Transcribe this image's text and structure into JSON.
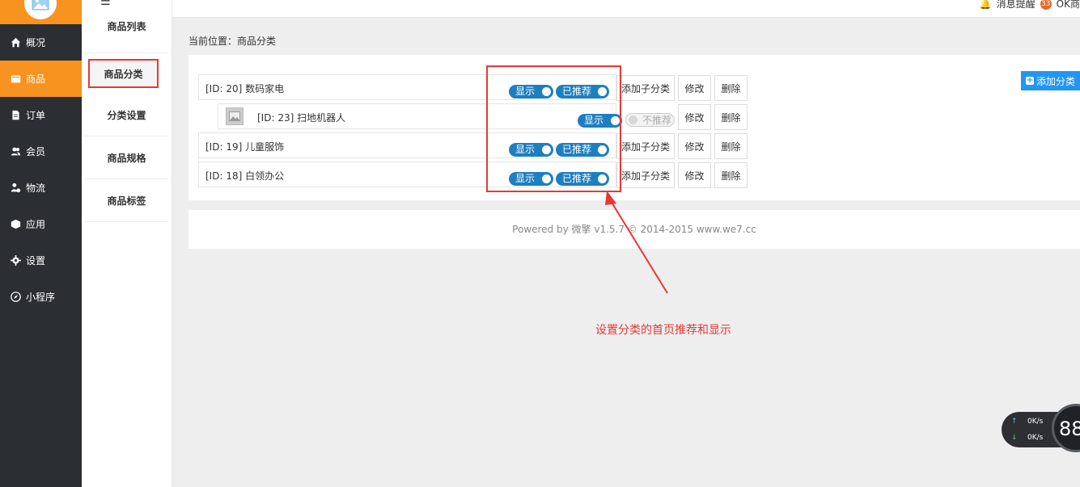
{
  "sidebar": {
    "items": [
      {
        "label": "概况",
        "icon": "home-icon"
      },
      {
        "label": "商品",
        "icon": "box-icon"
      },
      {
        "label": "订单",
        "icon": "document-icon"
      },
      {
        "label": "会员",
        "icon": "users-icon"
      },
      {
        "label": "物流",
        "icon": "truck-icon"
      },
      {
        "label": "应用",
        "icon": "cube-icon"
      },
      {
        "label": "设置",
        "icon": "gear-icon"
      },
      {
        "label": "小程序",
        "icon": "compass-icon"
      }
    ],
    "active_index": 1
  },
  "submenu": {
    "items": [
      "商品列表",
      "商品分类",
      "分类设置",
      "商品规格",
      "商品标签"
    ],
    "active_index": 1
  },
  "topbar": {
    "notification": "消息提醒",
    "badge": "33",
    "user": "OK商"
  },
  "breadcrumb": "当前位置：商品分类",
  "add_category_label": "添加分类",
  "categories": [
    {
      "name": "[ID: 20] 数码家电",
      "show_label": "显示",
      "recommend_label": "已推荐",
      "recommended": true,
      "add_child": "添加子分类",
      "edit": "修改",
      "delete": "删除"
    },
    {
      "name": "[ID: 23] 扫地机器人",
      "show_label": "显示",
      "recommend_label": "不推荐",
      "recommended": false,
      "edit": "修改",
      "delete": "删除"
    },
    {
      "name": "[ID: 19] 儿童服饰",
      "show_label": "显示",
      "recommend_label": "已推荐",
      "recommended": true,
      "add_child": "添加子分类",
      "edit": "修改",
      "delete": "删除"
    },
    {
      "name": "[ID: 18] 白领办公",
      "show_label": "显示",
      "recommend_label": "已推荐",
      "recommended": true,
      "add_child": "添加子分类",
      "edit": "修改",
      "delete": "删除"
    }
  ],
  "footer": "Powered by 微擎 v1.5.7 © 2014-2015 www.we7.cc",
  "annotation": "设置分类的首页推荐和显示",
  "speed": {
    "up": "0K/s",
    "down": "0K/s",
    "value": "88"
  },
  "colors": {
    "accent": "#f7931e",
    "toggle": "#1e7fc0",
    "annotation": "#e53935",
    "sidebar": "#2b2e33"
  }
}
